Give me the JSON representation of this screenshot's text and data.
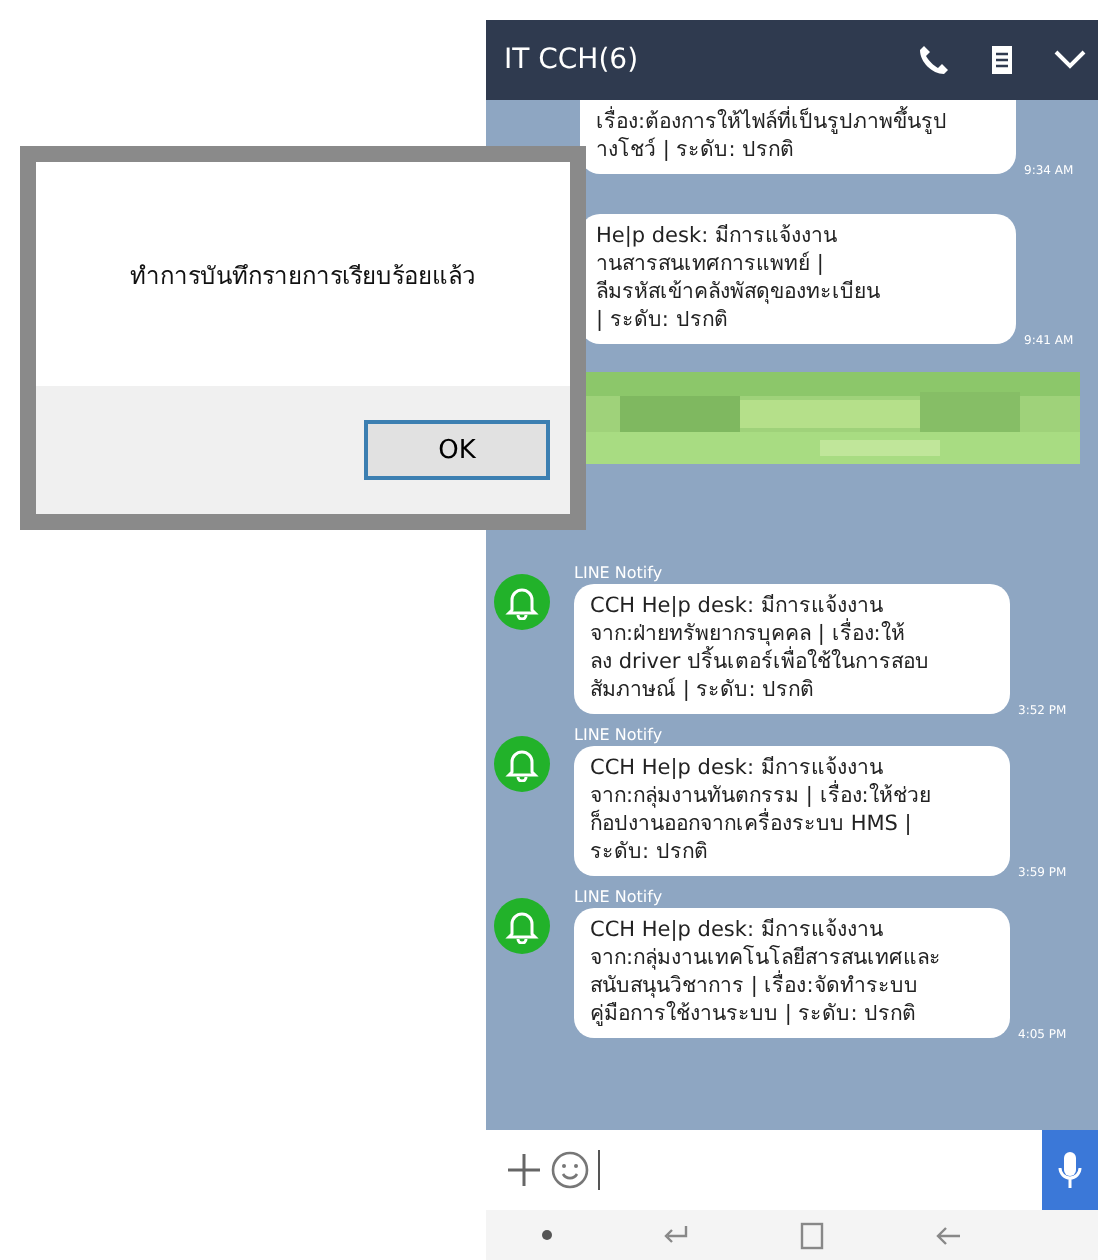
{
  "chat": {
    "title": "IT CCH(6)"
  },
  "messages": [
    {
      "kind": "bubble",
      "text": "เรื่อง:ต้องการให้ไฟล์ที่เป็นรูปภาพขึ้นรูป\nางโชว์ | ระดับ: ปรกติ",
      "time": "9:34 AM"
    },
    {
      "kind": "bubble",
      "text": "He|p desk: มีการแจ้งงาน\nานสารสนเทศการแพทย์ |\nลีมรหัสเข้าคลังพัสดุของทะเบียน\n| ระดับ: ปรกติ",
      "time": "9:41 AM"
    },
    {
      "kind": "picture"
    },
    {
      "kind": "notify",
      "sender": "LINE Notify",
      "text": "CCH He|p desk: มีการแจ้งงาน\nจาก:ฝ่ายทรัพยากรบุคคล  | เรื่อง:ให้\nลง driver ปริ้นเตอร์เพื่อใช้ในการสอบ\nสัมภาษณ์ | ระดับ: ปรกติ",
      "time": "3:52 PM"
    },
    {
      "kind": "notify",
      "sender": "LINE Notify",
      "text": "CCH He|p desk: มีการแจ้งงาน\nจาก:กลุ่มงานทันตกรรม  | เรื่อง:ให้ช่วย\nก็อปงานออกจากเครื่องระบบ HMS  |\nระดับ: ปรกติ",
      "time": "3:59 PM"
    },
    {
      "kind": "notify",
      "sender": "LINE Notify",
      "text": "CCH He|p desk: มีการแจ้งงาน\nจาก:กลุ่มงานเทคโนโลยีสารสนเทศและ\nสนับสนุนวิชาการ  | เรื่อง:จัดทำระบบ\nคู่มือการใช้งานระบบ | ระดับ: ปรกติ",
      "time": "4:05 PM"
    }
  ],
  "dialog": {
    "message": "ทำการบันทึกรายการเรียบร้อยแล้ว",
    "button": "OK"
  }
}
